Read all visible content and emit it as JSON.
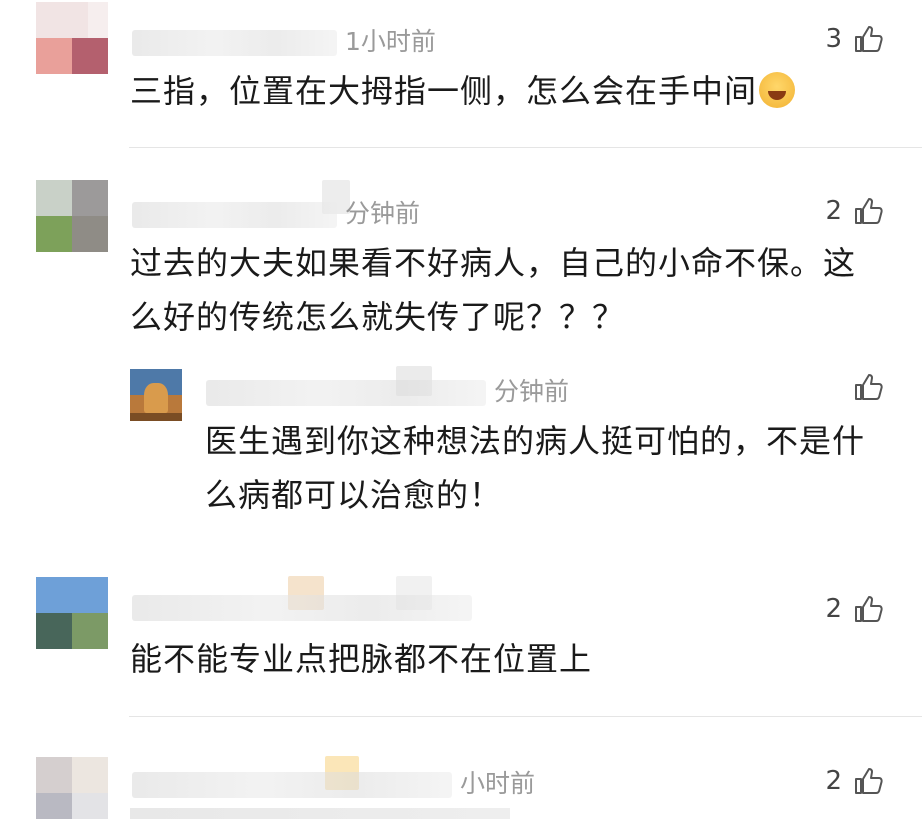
{
  "comments": [
    {
      "time": "1小时前",
      "text": "三指，位置在大拇指一侧，怎么会在手中间",
      "likes": "3",
      "emoji": "laugh-cry-emoji"
    },
    {
      "time": "分钟前",
      "text_line1": "过去的大夫如果看不好病人，自己的小命不保。这",
      "text_line2": "么好的传统怎么就失传了呢？？？",
      "likes": "2"
    },
    {
      "time": "分钟前",
      "text_line1": "医生遇到你这种想法的病人挺可怕的，不是什",
      "text_line2": "么病都可以治愈的！",
      "likes": ""
    },
    {
      "time": "",
      "text": "能不能专业点把脉都不在位置上",
      "likes": "2"
    },
    {
      "time": "小时前",
      "text": "",
      "likes": "2"
    }
  ],
  "colors": {
    "meta_gray": "#9a9a9a",
    "text": "#1a1a1a",
    "divider": "#e5e5e5"
  },
  "icons": {
    "like": "thumbs-up-icon"
  }
}
